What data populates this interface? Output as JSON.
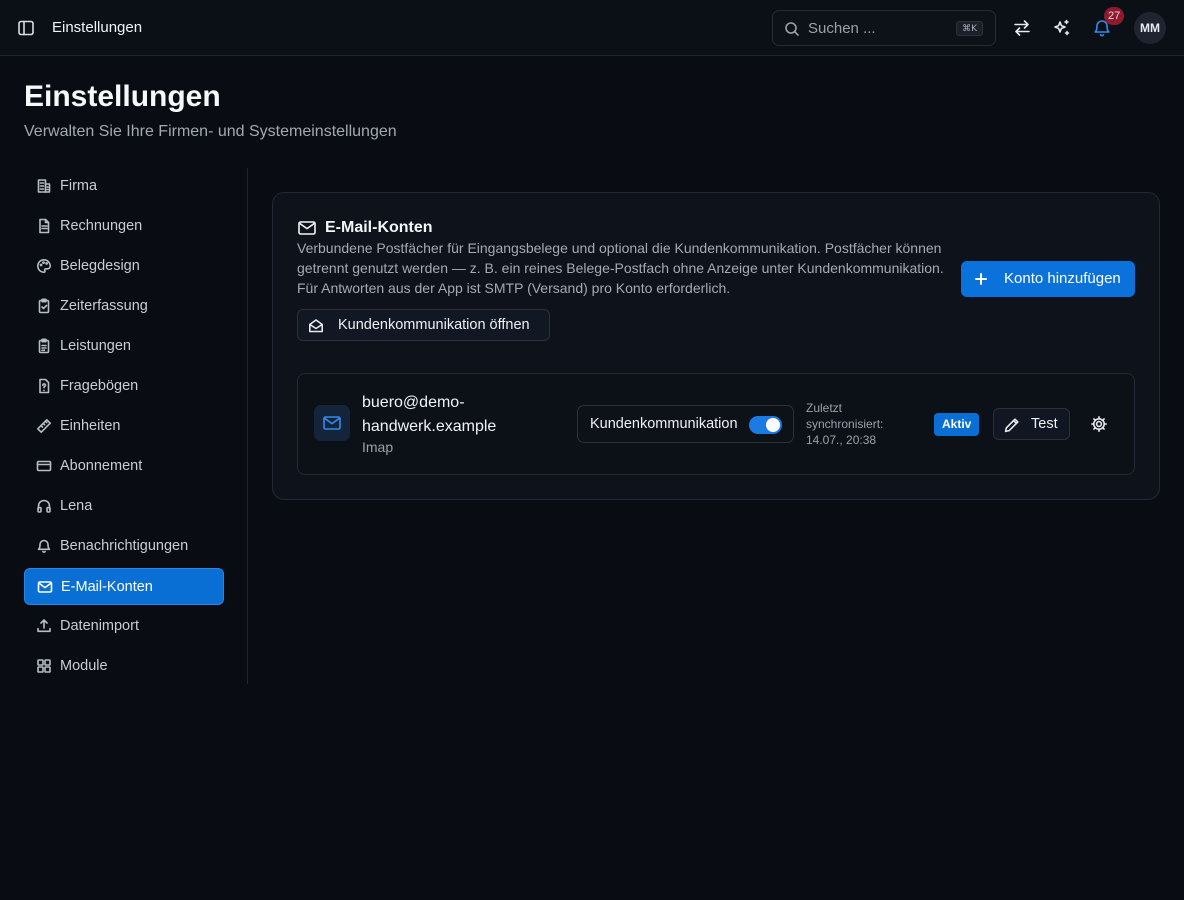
{
  "topbar": {
    "title": "Einstellungen",
    "search_placeholder": "Suchen ...",
    "search_shortcut": "⌘K",
    "notification_count": "27",
    "user_initials": "MM"
  },
  "page": {
    "title": "Einstellungen",
    "subtitle": "Verwalten Sie Ihre Firmen- und Systemeinstellungen"
  },
  "nav": {
    "items": [
      {
        "label": "Firma",
        "icon": "building-icon"
      },
      {
        "label": "Rechnungen",
        "icon": "document-icon"
      },
      {
        "label": "Belegdesign",
        "icon": "palette-icon"
      },
      {
        "label": "Zeiterfassung",
        "icon": "clipboard-check-icon"
      },
      {
        "label": "Leistungen",
        "icon": "clipboard-list-icon"
      },
      {
        "label": "Fragebögen",
        "icon": "question-file-icon"
      },
      {
        "label": "Einheiten",
        "icon": "ruler-icon"
      },
      {
        "label": "Abonnement",
        "icon": "credit-card-icon"
      },
      {
        "label": "Lena",
        "icon": "headphones-icon"
      },
      {
        "label": "Benachrichtigungen",
        "icon": "bell-icon"
      },
      {
        "label": "E-Mail-Konten",
        "icon": "mail-icon",
        "active": true
      },
      {
        "label": "Datenimport",
        "icon": "upload-icon"
      },
      {
        "label": "Module",
        "icon": "grid-icon"
      }
    ]
  },
  "card": {
    "title": "E-Mail-Konten",
    "description": "Verbundene Postfächer für Eingangsbelege und optional die Kundenkommunikation. Postfächer können getrennt genutzt werden — z. B. ein reines Belege-Postfach ohne Anzeige unter Kundenkommunikation. Für Antworten aus der App ist SMTP (Versand) pro Konto erforderlich.",
    "add_button": "Konto hinzufügen",
    "open_communication_button": "Kundenkommunikation öffnen"
  },
  "accounts": [
    {
      "email": "buero@demo-handwerk.example",
      "type": "Imap",
      "communication_label": "Kundenkommunikation",
      "communication_enabled": true,
      "sync_label": "Zuletzt synchronisiert:",
      "sync_time": "14.07., 20:38",
      "status": "Aktiv",
      "test_button": "Test"
    }
  ],
  "colors": {
    "accent": "#0a6fd4",
    "background": "#090c12",
    "badge": "#8d1b2d"
  }
}
